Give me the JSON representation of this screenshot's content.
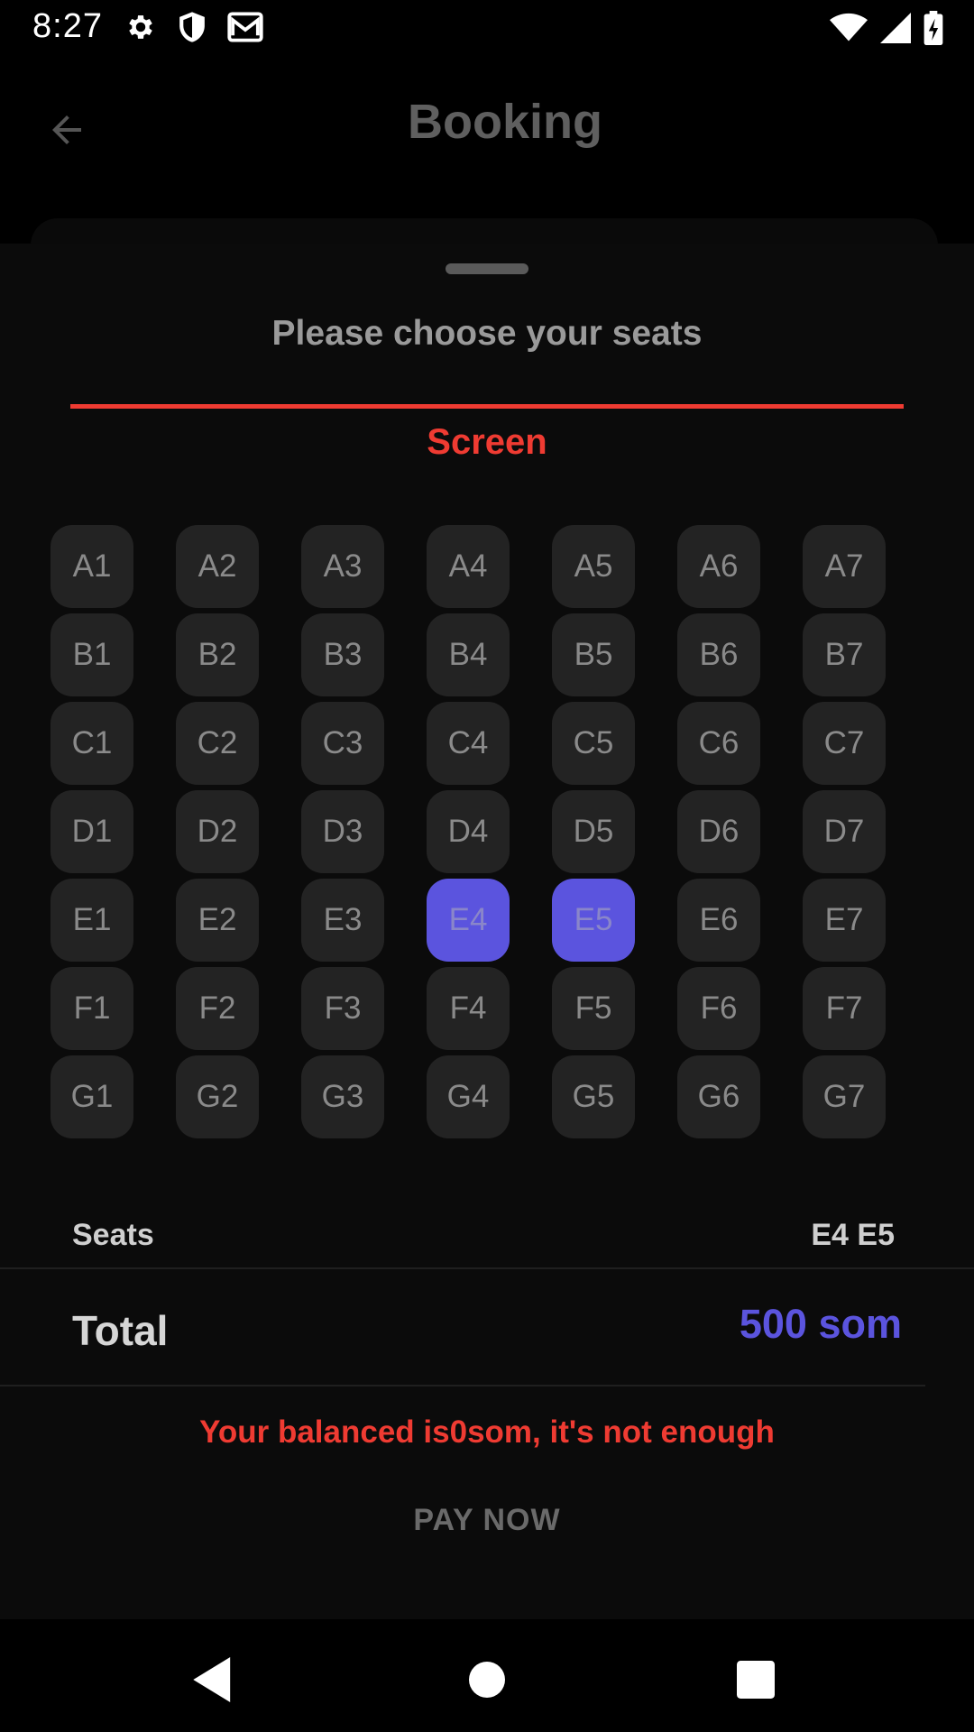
{
  "status_bar": {
    "time": "8:27",
    "left_icons": [
      "gear-icon",
      "shield-icon",
      "mail-icon"
    ],
    "right_icons": [
      "wifi-icon",
      "signal-icon",
      "battery-charging-icon"
    ]
  },
  "app_bar": {
    "title": "Booking",
    "back_icon": "arrow-back-icon"
  },
  "sheet": {
    "title": "Please choose your seats",
    "screen_label": "Screen",
    "seat_rows": [
      {
        "row": "A",
        "seats": [
          "A1",
          "A2",
          "A3",
          "A4",
          "A5",
          "A6",
          "A7"
        ]
      },
      {
        "row": "B",
        "seats": [
          "B1",
          "B2",
          "B3",
          "B4",
          "B5",
          "B6",
          "B7"
        ]
      },
      {
        "row": "C",
        "seats": [
          "C1",
          "C2",
          "C3",
          "C4",
          "C5",
          "C6",
          "C7"
        ]
      },
      {
        "row": "D",
        "seats": [
          "D1",
          "D2",
          "D3",
          "D4",
          "D5",
          "D6",
          "D7"
        ]
      },
      {
        "row": "E",
        "seats": [
          "E1",
          "E2",
          "E3",
          "E4",
          "E5",
          "E6",
          "E7"
        ]
      },
      {
        "row": "F",
        "seats": [
          "F1",
          "F2",
          "F3",
          "F4",
          "F5",
          "F6",
          "F7"
        ]
      },
      {
        "row": "G",
        "seats": [
          "G1",
          "G2",
          "G3",
          "G4",
          "G5",
          "G6",
          "G7"
        ]
      }
    ],
    "selected_seats": [
      "E4",
      "E5"
    ],
    "seats_label": "Seats",
    "seats_value": "E4 E5",
    "total_label": "Total",
    "total_value": "500 som",
    "warning": "Your balanced is0som, it's not enough",
    "pay_button": "PAY NOW"
  },
  "colors": {
    "accent": "#5b54de",
    "error": "#ef3b32",
    "seat_bg": "#232323",
    "background": "#0b0b0b"
  },
  "nav_bar": {
    "icons": [
      "nav-back-icon",
      "nav-home-icon",
      "nav-recents-icon"
    ]
  }
}
